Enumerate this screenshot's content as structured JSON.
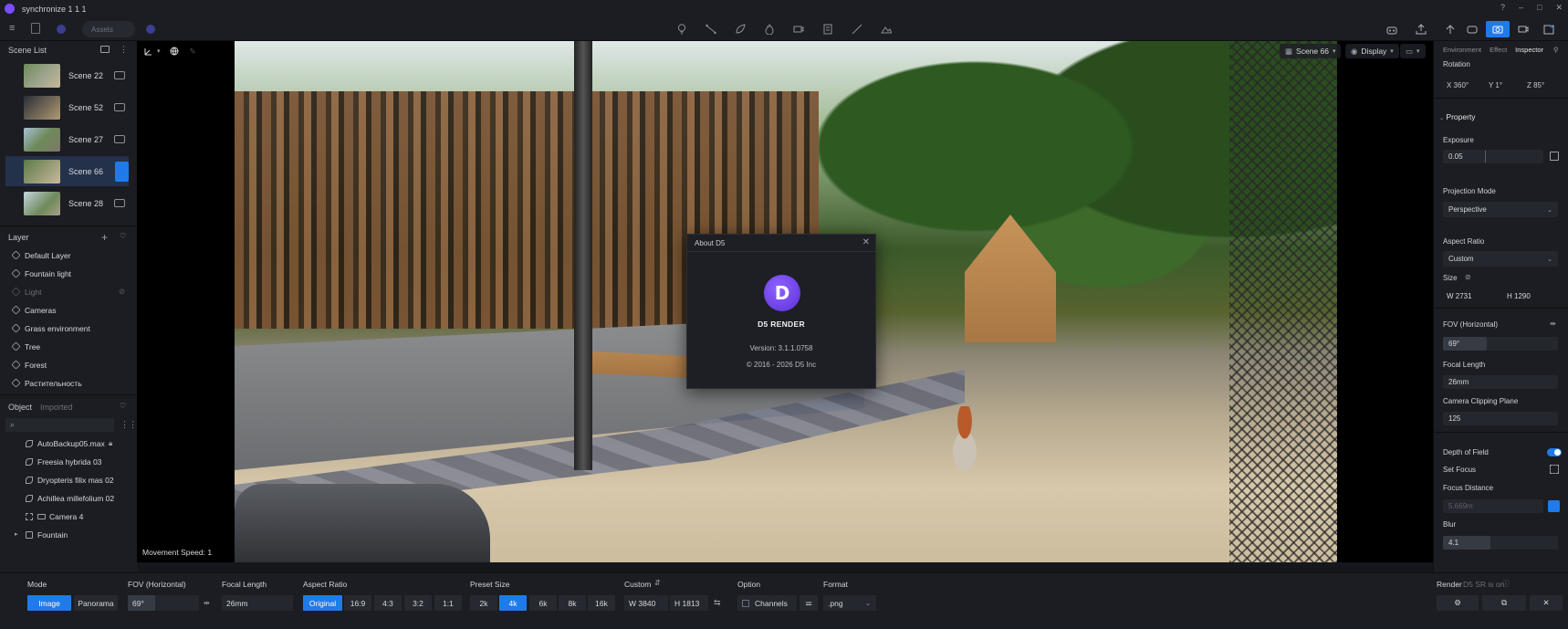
{
  "app": {
    "title": "synchronize 1 1 1"
  },
  "toolbar": {
    "assets_placeholder": "Assets"
  },
  "scene_list": {
    "title": "Scene List",
    "scenes": [
      {
        "label": "Scene 22"
      },
      {
        "label": "Scene 52"
      },
      {
        "label": "Scene 27"
      },
      {
        "label": "Scene 66",
        "active": true
      },
      {
        "label": "Scene 28"
      }
    ]
  },
  "layers": {
    "title": "Layer",
    "items": [
      {
        "label": "Default Layer"
      },
      {
        "label": "Fountain light"
      },
      {
        "label": "Light",
        "hidden": true
      },
      {
        "label": "Cameras"
      },
      {
        "label": "Grass environment"
      },
      {
        "label": "Tree"
      },
      {
        "label": "Forest"
      },
      {
        "label": "Растительность"
      }
    ]
  },
  "objects": {
    "tab_object": "Object",
    "tab_imported": "Imported",
    "items": [
      {
        "label": "AutoBackup05.max"
      },
      {
        "label": "Freesia hybrida 03"
      },
      {
        "label": "Dryopteris filix mas 02"
      },
      {
        "label": "Achillea millefolium 02"
      },
      {
        "label": "Camera 4"
      },
      {
        "label": "Fountain"
      }
    ]
  },
  "viewport": {
    "scene_select": "Scene 66",
    "display_label": "Display",
    "movement_speed": "Movement Speed: 1"
  },
  "about_dialog": {
    "title": "About D5",
    "product": "D5 RENDER",
    "version": "Version: 3.1.1.0758",
    "copyright": "© 2016 - 2026 D5 Inc"
  },
  "inspector": {
    "tabs": [
      "Environment",
      "Effect",
      "Inspector"
    ],
    "rotation_label": "Rotation",
    "rotation": {
      "x": "X 360°",
      "y": "Y 1°",
      "z": "Z 85°"
    },
    "property_label": "Property",
    "exposure_label": "Exposure",
    "exposure_value": "0.05",
    "projection_label": "Projection Mode",
    "projection_value": "Perspective",
    "aspect_label": "Aspect Ratio",
    "aspect_value": "Custom",
    "size_label": "Size",
    "size_w": "W 2731",
    "size_h": "H 1290",
    "fov_label": "FOV (Horizontal)",
    "fov_value": "69°",
    "focal_label": "Focal Length",
    "focal_value": "26mm",
    "clip_label": "Camera Clipping Plane",
    "clip_value": "125",
    "dof_label": "Depth of Field",
    "set_focus_label": "Set Focus",
    "focus_distance_label": "Focus Distance",
    "focus_distance_value": "5.669m",
    "blur_label": "Blur",
    "blur_value": "4.1"
  },
  "bottom": {
    "mode_label": "Mode",
    "mode_image": "Image",
    "mode_panorama": "Panorama",
    "fov_label": "FOV (Horizontal)",
    "fov_value": "69°",
    "focal_label": "Focal Length",
    "focal_value": "26mm",
    "aspect_label": "Aspect Ratio",
    "aspect_options": [
      "Original",
      "16:9",
      "4:3",
      "3:2",
      "1:1"
    ],
    "preset_label": "Preset Size",
    "preset_options": [
      "2k",
      "4k",
      "6k",
      "8k",
      "16k"
    ],
    "custom_label": "Custom",
    "custom_w": "W 3840",
    "custom_h": "H 1813",
    "option_label": "Option",
    "channels_label": "Channels",
    "format_label": "Format",
    "format_value": ".png",
    "render_label": "Render",
    "render_note": "D5 SR is on"
  },
  "colors": {
    "accent": "#1f7bea",
    "brand": "#7b4dff"
  }
}
